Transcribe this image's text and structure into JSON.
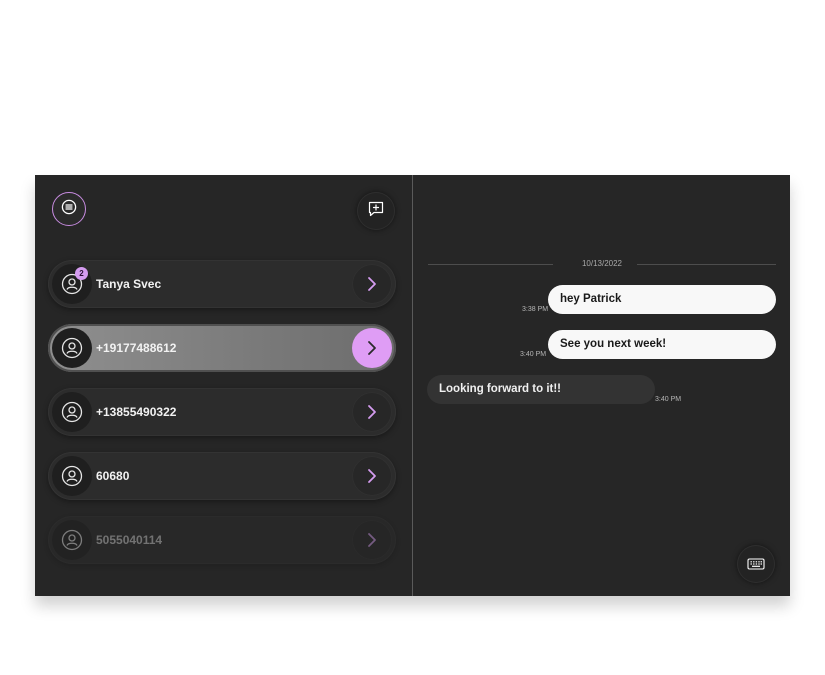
{
  "colors": {
    "accent": "#df9df5",
    "panel_bg": "#262626",
    "active_row": "#8f8f8f",
    "outgoing_bubble": "#f8f8f8",
    "incoming_bubble": "#333333"
  },
  "sidebar": {
    "menu_icon": "menu-lines-icon",
    "new_message_icon": "new-message-icon",
    "conversations": [
      {
        "name": "Tanya Svec",
        "unread": "2",
        "icon": "user-icon"
      },
      {
        "name": "+19177488612",
        "unread": "",
        "icon": "user-icon"
      },
      {
        "name": "+13855490322",
        "unread": "",
        "icon": "user-icon"
      },
      {
        "name": "60680",
        "unread": "",
        "icon": "user-icon"
      },
      {
        "name": "5055040114",
        "unread": "",
        "icon": "user-icon"
      }
    ]
  },
  "chat": {
    "date": "10/13/2022",
    "messages": [
      {
        "direction": "outgoing",
        "text": "hey Patrick",
        "time": "3:38 PM"
      },
      {
        "direction": "outgoing",
        "text": "See you next week!",
        "time": "3:40 PM"
      },
      {
        "direction": "incoming",
        "text": "Looking forward to it!!",
        "time": "3:40 PM"
      }
    ],
    "keyboard_icon": "keyboard-icon"
  }
}
